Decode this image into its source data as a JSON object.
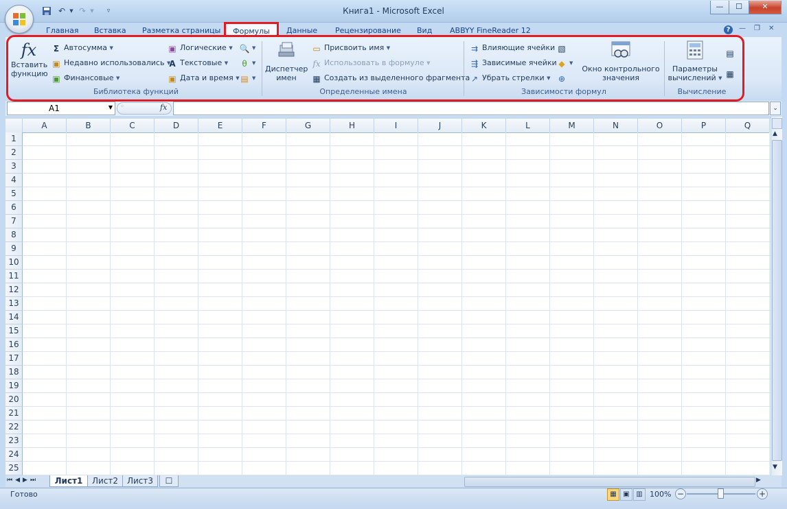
{
  "window": {
    "title": "Книга1 - Microsoft Excel",
    "minimize": "—",
    "maximize": "☐",
    "close": "✕",
    "ribbon_minimize": "—",
    "ribbon_restore": "❐",
    "ribbon_close": "✕",
    "help": "?"
  },
  "qat": {
    "save_icon": "save-icon",
    "undo_icon": "undo-icon",
    "redo_icon": "redo-icon",
    "customize_icon": "customize-icon"
  },
  "tabs": [
    {
      "label": "Главная"
    },
    {
      "label": "Вставка"
    },
    {
      "label": "Разметка страницы"
    },
    {
      "label": "Формулы"
    },
    {
      "label": "Данные"
    },
    {
      "label": "Рецензирование"
    },
    {
      "label": "Вид"
    },
    {
      "label": "ABBYY FineReader 12"
    }
  ],
  "ribbon": {
    "function_library": {
      "label": "Библиотека функций",
      "insert_function_line1": "Вставить",
      "insert_function_line2": "функцию",
      "fx_glyph": "fx",
      "autosum": "Автосумма",
      "recent": "Недавно использовались",
      "financial": "Финансовые",
      "logical": "Логические",
      "text": "Текстовые",
      "datetime": "Дата и время"
    },
    "defined_names": {
      "label": "Определенные имена",
      "manager_line1": "Диспетчер",
      "manager_line2": "имен",
      "assign_name": "Присвоить имя",
      "use_in_formula": "Использовать в формуле",
      "create_from_selection": "Создать из выделенного фрагмента"
    },
    "formula_auditing": {
      "label": "Зависимости формул",
      "precedents": "Влияющие ячейки",
      "dependents": "Зависимые ячейки",
      "remove_arrows": "Убрать стрелки",
      "watch_window_line1": "Окно контрольного",
      "watch_window_line2": "значения"
    },
    "calculation": {
      "label": "Вычисление",
      "options_line1": "Параметры",
      "options_line2": "вычислений"
    }
  },
  "formula_bar": {
    "name_box": "A1",
    "fx": "fx",
    "value": ""
  },
  "grid": {
    "columns": [
      "A",
      "B",
      "C",
      "D",
      "E",
      "F",
      "G",
      "H",
      "I",
      "J",
      "K",
      "L",
      "M",
      "N",
      "O",
      "P",
      "Q"
    ],
    "rows": [
      "1",
      "2",
      "3",
      "4",
      "5",
      "6",
      "7",
      "8",
      "9",
      "10",
      "11",
      "12",
      "13",
      "14",
      "15",
      "16",
      "17",
      "18",
      "19",
      "20",
      "21",
      "22",
      "23",
      "24",
      "25"
    ]
  },
  "sheets": [
    {
      "label": "Лист1"
    },
    {
      "label": "Лист2"
    },
    {
      "label": "Лист3"
    }
  ],
  "status": {
    "ready": "Готово",
    "zoom": "100%"
  },
  "colors": {
    "highlight": "#e21b23",
    "ribbon_bg": "#dbe8f7",
    "text": "#1e395b"
  }
}
